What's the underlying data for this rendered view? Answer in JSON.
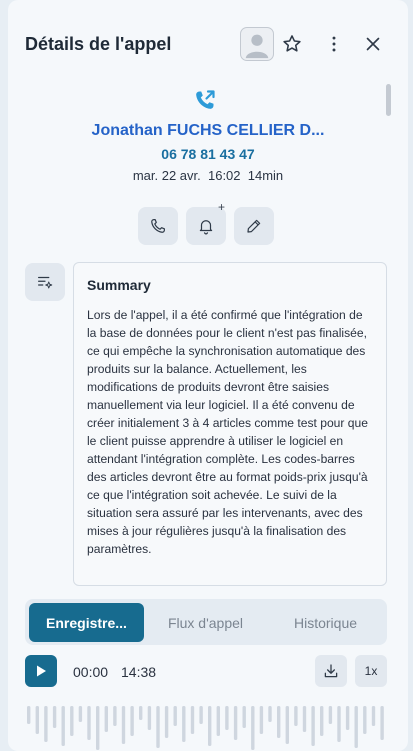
{
  "header": {
    "title": "Détails de l'appel",
    "favorite_icon": "star-icon",
    "more_icon": "more-vertical-icon",
    "close_icon": "close-icon"
  },
  "call": {
    "direction_icon": "outgoing-call-icon",
    "contact_name": "Jonathan FUCHS CELLIER D...",
    "phone": "06 78 81 43 47",
    "date_time_duration": "mar. 22 avr.  16:02  14min"
  },
  "actions": [
    {
      "name": "call-button",
      "icon": "phone-icon"
    },
    {
      "name": "reminder-button",
      "icon": "bell-plus-icon",
      "badge": "+"
    },
    {
      "name": "edit-button",
      "icon": "pencil-icon"
    }
  ],
  "summary": {
    "icon": "ai-summary-icon",
    "title": "Summary",
    "text": "Lors de l'appel, il a été confirmé que l'intégration de la base de données pour le client n'est pas finalisée, ce qui empêche la synchronisation automatique des produits sur la balance. Actuellement, les modifications de produits devront être saisies manuellement via leur logiciel. Il a été convenu de créer initialement 3 à 4 articles comme test pour que le client puisse apprendre à utiliser le logiciel en attendant l'intégration complète. Les codes-barres des articles devront être au format poids-prix jusqu'à ce que l'intégration soit achevée. Le suivi de la situation sera assuré par les intervenants, avec des mises à jour régulières jusqu'à la finalisation des paramètres."
  },
  "tabs": [
    {
      "label": "Enregistre...",
      "active": true
    },
    {
      "label": "Flux d'appel",
      "active": false
    },
    {
      "label": "Historique",
      "active": false
    }
  ],
  "player": {
    "current_time": "00:00",
    "total_time": "14:38",
    "speed": "1x",
    "download_icon": "download-icon",
    "play_icon": "play-icon"
  },
  "colors": {
    "accent": "#176b8f",
    "link": "#2563c8",
    "phone": "#1a6fa0"
  }
}
